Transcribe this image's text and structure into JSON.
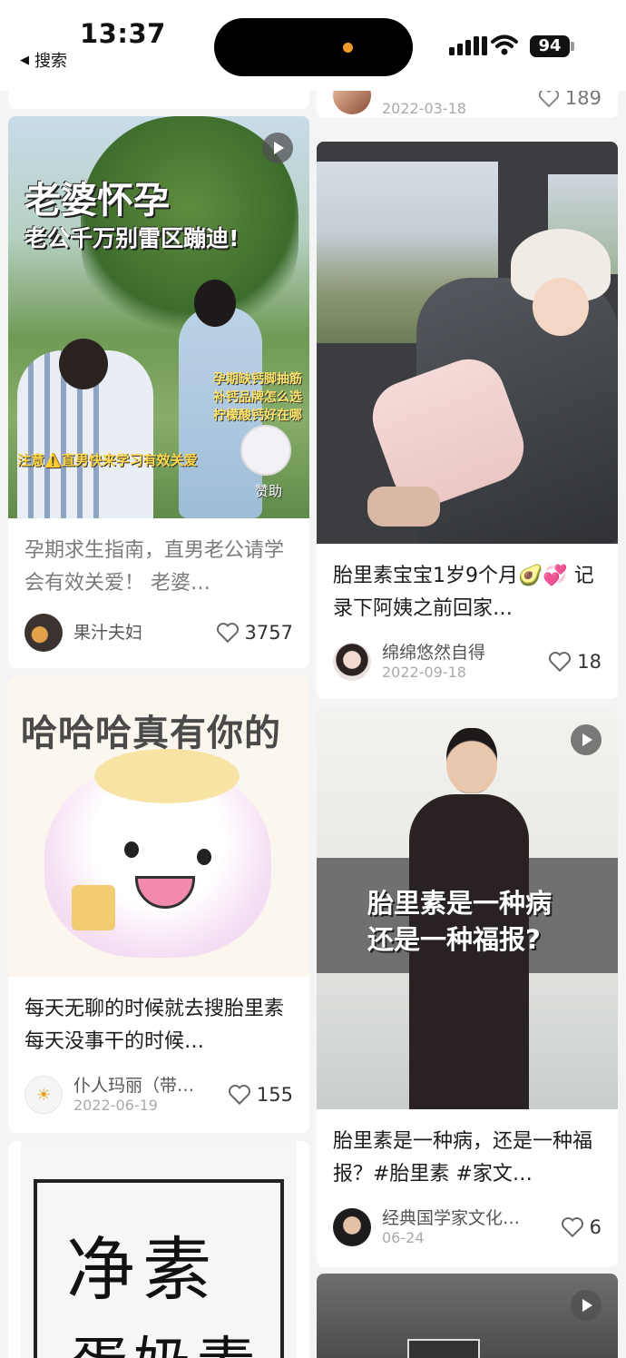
{
  "status_bar": {
    "time": "13:37",
    "back_label": "搜索",
    "battery": "94",
    "back_icon": "back-triangle-icon",
    "signal_icon": "cellular-signal-icon",
    "wifi_icon": "wifi-icon"
  },
  "colors": {
    "background": "#f4f4f4",
    "card": "#ffffff",
    "island_indicator": "#f39a2d"
  },
  "feed": {
    "partial_top_right": {
      "date": "2022-03-18",
      "likes": "189"
    },
    "cards": [
      {
        "overlay_title": "老婆怀孕",
        "overlay_subtitle": "老公千万别雷区蹦迪!",
        "overlay_side": "孕期缺钙脚抽筋 补钙品牌怎么选 柠檬酸钙好在哪",
        "overlay_bottom": "注意⚠️直男快来学习有效关爱",
        "overlay_sponsor": "赞助",
        "title": "孕期求生指南，直男老公请学会有效关爱！ 老婆…",
        "author": "果汁夫妇",
        "likes": "3757",
        "is_video": true
      },
      {
        "title": "胎里素宝宝1岁9个月🥑💞 记录下阿姨之前回家…",
        "author": "绵绵悠然自得",
        "date": "2022-09-18",
        "likes": "18",
        "is_video": false
      },
      {
        "overlay_title": "哈哈哈真有你的",
        "title": "每天无聊的时候就去搜胎里素 每天没事干的时候…",
        "author": "仆人玛丽（带…",
        "date": "2022-06-19",
        "likes": "155",
        "is_video": false
      },
      {
        "overlay_line1": "胎里素是一种病",
        "overlay_line2": "还是一种福报?",
        "title": "胎里素是一种病，还是一种福报？#胎里素 #家文…",
        "author": "经典国学家文化…",
        "date": "06-24",
        "likes": "6",
        "is_video": true
      },
      {
        "overlay_line1": "净素",
        "overlay_line2": "蛋奶素"
      },
      {
        "is_video": true
      }
    ]
  }
}
